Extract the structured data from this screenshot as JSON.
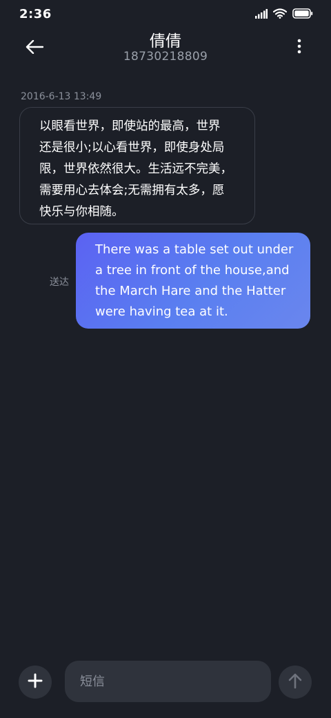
{
  "status_bar": {
    "time": "2:36",
    "icons": [
      "signal-icon",
      "wifi-icon",
      "battery-icon"
    ]
  },
  "header": {
    "back_icon": "back-arrow-icon",
    "contact_name": "倩倩",
    "contact_number": "18730218809",
    "more_icon": "more-vertical-icon"
  },
  "messages": {
    "timestamp": "2016-6-13 13:49",
    "incoming": {
      "lines": [
        "以眼看世界，即使站的最高，世界",
        "还是很小;以心看世界，即使身处局",
        "限，世界依然很大。生活远不完美，",
        "需要用心去体会;无需拥有太多，愿",
        "快乐与你相随。"
      ]
    },
    "outgoing": {
      "lines": [
        "There was a table set out under",
        "a tree in front of the house,and",
        "the March Hare and the Hatter",
        "were having tea at it."
      ],
      "status": "送达"
    }
  },
  "composer": {
    "add_icon": "plus-icon",
    "placeholder": "短信",
    "send_icon": "send-arrow-up-icon"
  },
  "colors": {
    "background": "#1c1f27",
    "outgoing_bubble": "#5b6ff1",
    "control_bg": "#2f333c",
    "secondary_text": "#8b909b"
  }
}
